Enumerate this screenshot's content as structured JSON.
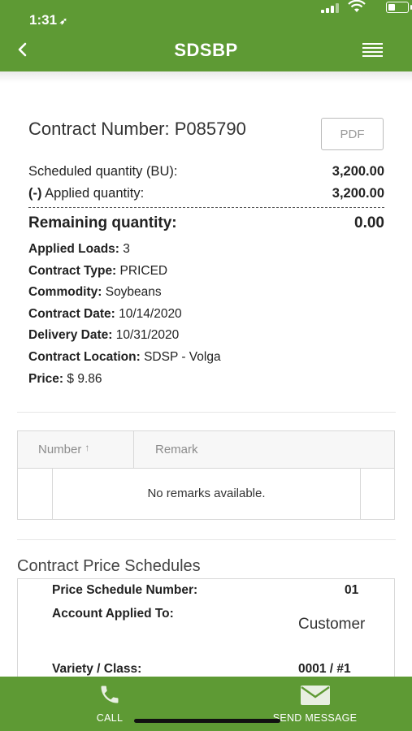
{
  "status": {
    "time": "1:31"
  },
  "header": {
    "title": "SDSBP"
  },
  "contract": {
    "number_label": "Contract Number: P085790",
    "pdf_label": "PDF",
    "scheduled_label": "Scheduled quantity (BU):",
    "scheduled_value": "3,200.00",
    "applied_prefix": "(-)",
    "applied_label": " Applied quantity:",
    "applied_value": "3,200.00",
    "remaining_label": "Remaining quantity:",
    "remaining_value": "0.00",
    "details": [
      {
        "label": "Applied Loads:",
        "value": " 3"
      },
      {
        "label": "Contract Type:",
        "value": " PRICED"
      },
      {
        "label": "Commodity:",
        "value": " Soybeans"
      },
      {
        "label": "Contract Date:",
        "value": " 10/14/2020"
      },
      {
        "label": "Delivery Date:",
        "value": " 10/31/2020"
      },
      {
        "label": "Contract Location:",
        "value": " SDSP - Volga"
      },
      {
        "label": "Price:",
        "value": " $ 9.86"
      }
    ]
  },
  "remarks": {
    "columns": [
      "Number",
      "Remark"
    ],
    "sort_indicator": "↑",
    "empty_text": "No remarks available."
  },
  "schedules": {
    "title": "Contract Price Schedules",
    "number_label": "Price Schedule Number:",
    "number_value": "01",
    "account_label": "Account Applied To:",
    "account_value": "Customer",
    "variety_label": "Variety / Class:",
    "variety_value": "0001 / #1"
  },
  "bottom_nav": {
    "call_label": "CALL",
    "message_label": "SEND MESSAGE"
  },
  "colors": {
    "brand_green": "#5e9a34"
  }
}
